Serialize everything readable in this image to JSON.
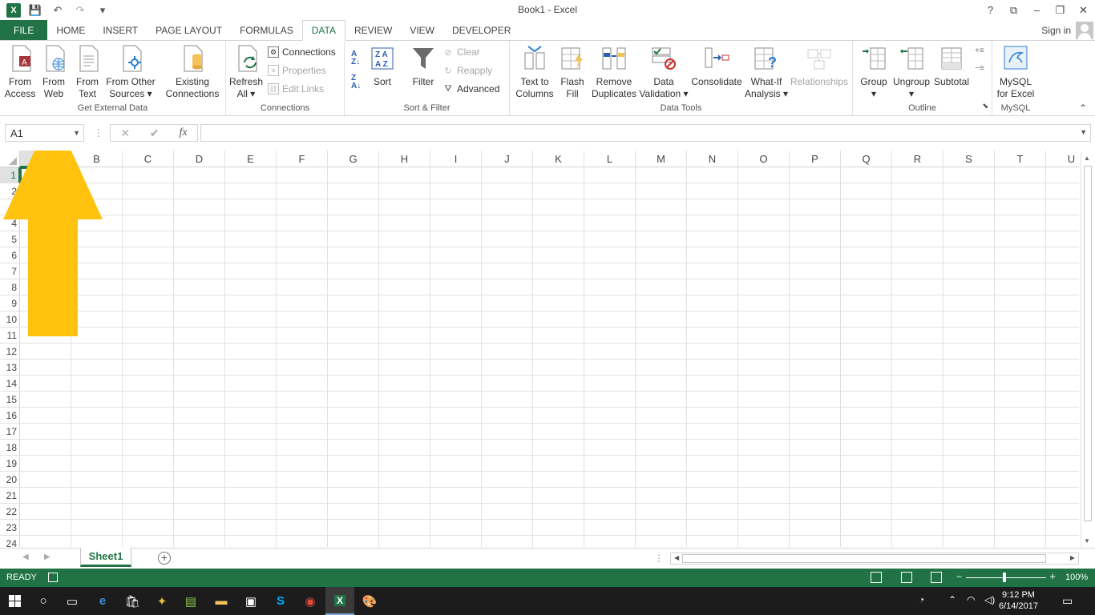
{
  "window": {
    "title": "Book1 - Excel",
    "help": "?",
    "controls": [
      "⧉",
      "–",
      "❐",
      "✕"
    ]
  },
  "qat": {
    "save": "💾",
    "undo": "↶",
    "redo": "↷",
    "customize": "▾"
  },
  "tabs": [
    "FILE",
    "HOME",
    "INSERT",
    "PAGE LAYOUT",
    "FORMULAS",
    "DATA",
    "REVIEW",
    "VIEW",
    "DEVELOPER"
  ],
  "active_tab": "DATA",
  "signin": "Sign in",
  "ribbon": {
    "get_external_data": {
      "label": "Get External Data",
      "from_access": [
        "From",
        "Access"
      ],
      "from_web": [
        "From",
        "Web"
      ],
      "from_text": [
        "From",
        "Text"
      ],
      "from_other": [
        "From Other",
        "Sources ▾"
      ],
      "existing": [
        "Existing",
        "Connections"
      ]
    },
    "connections": {
      "label": "Connections",
      "refresh": [
        "Refresh",
        "All ▾"
      ],
      "connections": "Connections",
      "properties": "Properties",
      "edit_links": "Edit Links"
    },
    "sort_filter": {
      "label": "Sort & Filter",
      "sort": "Sort",
      "filter": "Filter",
      "clear": "Clear",
      "reapply": "Reapply",
      "advanced": "Advanced"
    },
    "data_tools": {
      "label": "Data Tools",
      "text_to_columns": [
        "Text to",
        "Columns"
      ],
      "flash_fill": [
        "Flash",
        "Fill"
      ],
      "remove_duplicates": [
        "Remove",
        "Duplicates"
      ],
      "data_validation": [
        "Data",
        "Validation ▾"
      ],
      "consolidate": "Consolidate",
      "what_if": [
        "What-If",
        "Analysis ▾"
      ],
      "relationships": "Relationships"
    },
    "outline": {
      "label": "Outline",
      "group": [
        "Group",
        "▾"
      ],
      "ungroup": [
        "Ungroup",
        "▾"
      ],
      "subtotal": "Subtotal"
    },
    "mysql": {
      "label": "MySQL",
      "mysql_for_excel": [
        "MySQL",
        "for Excel"
      ]
    }
  },
  "formula_bar": {
    "name_box": "A1",
    "fx": "fx",
    "cancel": "✕",
    "enter": "✔",
    "value": ""
  },
  "columns": [
    "A",
    "B",
    "C",
    "D",
    "E",
    "F",
    "G",
    "H",
    "I",
    "J",
    "K",
    "L",
    "M",
    "N",
    "O",
    "P",
    "Q",
    "R",
    "S",
    "T",
    "U"
  ],
  "rows": [
    "1",
    "2",
    "3",
    "4",
    "5",
    "6",
    "7",
    "8",
    "9",
    "10",
    "11",
    "12",
    "13",
    "14",
    "15",
    "16",
    "17",
    "18",
    "19",
    "20",
    "21",
    "22",
    "23",
    "24"
  ],
  "selected_cell": "A1",
  "sheets": [
    "Sheet1"
  ],
  "status": {
    "mode": "READY",
    "zoom": "100%"
  },
  "taskbar": {
    "time": "9:12 PM",
    "date": "6/14/2017"
  },
  "colors": {
    "excel_green": "#217346",
    "arrow": "#ffc20e"
  }
}
